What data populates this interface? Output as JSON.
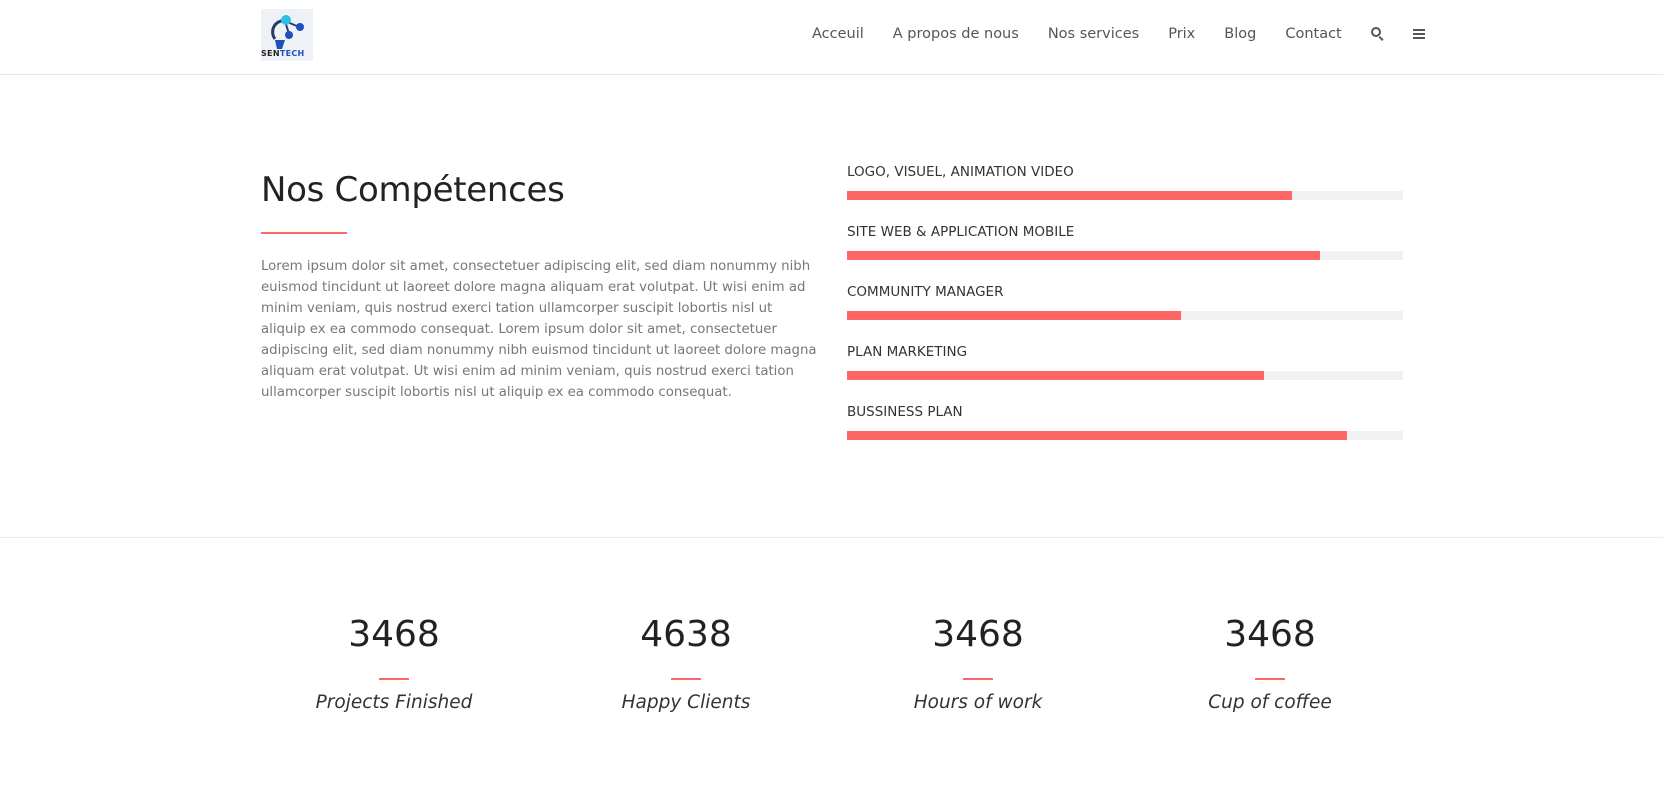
{
  "header": {
    "logo_text_prefix": "SEN",
    "logo_text_suffix": "TECH",
    "nav": [
      "Acceuil",
      "A propos de nous",
      "Nos services",
      "Prix",
      "Blog",
      "Contact"
    ],
    "icons": [
      "search-icon",
      "menu-icon"
    ]
  },
  "skills_section": {
    "title": "Nos Compétences",
    "paragraph": "Lorem ipsum dolor sit amet, consectetuer adipiscing elit, sed diam nonummy nibh euismod tincidunt ut laoreet dolore magna aliquam erat volutpat. Ut wisi enim ad minim veniam, quis nostrud exerci tation ullamcorper suscipit lobortis nisl ut aliquip ex ea commodo consequat. Lorem ipsum dolor sit amet, consectetuer adipiscing elit, sed diam nonummy nibh euismod tincidunt ut laoreet dolore magna aliquam erat volutpat. Ut wisi enim ad minim veniam, quis nostrud exerci tation ullamcorper suscipit lobortis nisl ut aliquip ex ea commodo consequat.",
    "skills": [
      {
        "label": "LOGO, VISUEL, ANIMATION VIDEO",
        "percent": 80
      },
      {
        "label": "SITE WEB & APPLICATION MOBILE",
        "percent": 85
      },
      {
        "label": "COMMUNITY MANAGER",
        "percent": 60
      },
      {
        "label": "PLAN MARKETING",
        "percent": 75
      },
      {
        "label": "BUSSINESS PLAN",
        "percent": 90
      }
    ]
  },
  "counters": [
    {
      "value": "3468",
      "label": "Projects Finished"
    },
    {
      "value": "4638",
      "label": "Happy Clients"
    },
    {
      "value": "3468",
      "label": "Hours of work"
    },
    {
      "value": "3468",
      "label": "Cup of coffee"
    }
  ],
  "colors": {
    "accent": "#ff6666",
    "track": "#f1f1f1",
    "nav_text": "#555555",
    "logo_blue": "#1d4fbf"
  }
}
